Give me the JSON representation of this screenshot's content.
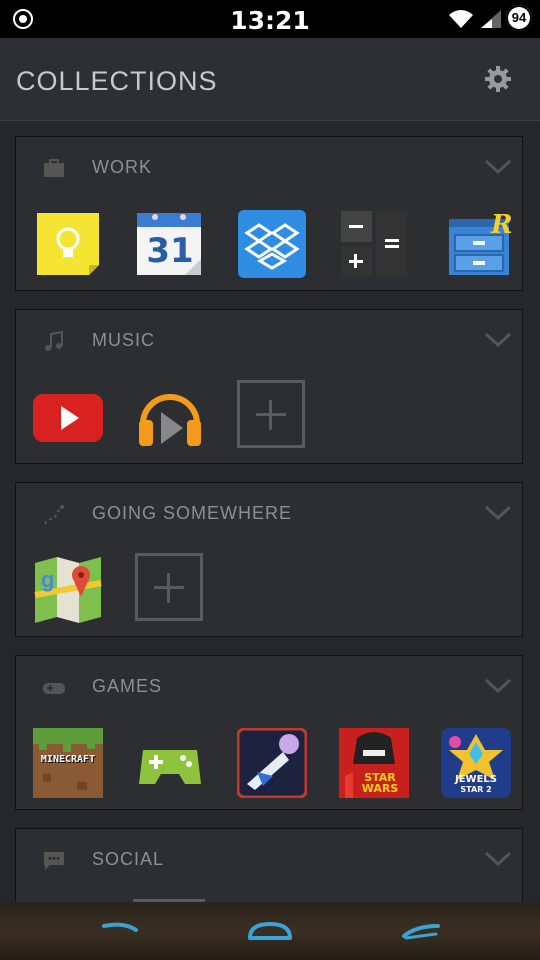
{
  "status_bar": {
    "time": "13:21",
    "battery": "94"
  },
  "header": {
    "title": "COLLECTIONS"
  },
  "collections": [
    {
      "title": "WORK",
      "icon": "briefcase-icon",
      "apps": [
        "keep-app-icon",
        "calendar-app-icon",
        "dropbox-app-icon",
        "calculator-app-icon",
        "file-explorer-app-icon"
      ],
      "calendar_day": "31"
    },
    {
      "title": "MUSIC",
      "icon": "music-note-icon",
      "apps": [
        "youtube-app-icon",
        "play-music-app-icon"
      ],
      "has_add": true
    },
    {
      "title": "GOING SOMEWHERE",
      "icon": "route-icon",
      "apps": [
        "maps-app-icon"
      ],
      "has_add": true
    },
    {
      "title": "GAMES",
      "icon": "gamepad-icon",
      "apps": [
        "minecraft-app-icon",
        "play-games-app-icon",
        "space-shooter-app-icon",
        "angry-birds-star-wars-app-icon",
        "jewels-star-2-app-icon"
      ],
      "minecraft_label": "MINECRAFT",
      "star_wars_label": "STAR WARS",
      "jewels_label": "JEWELS",
      "jewels_sub": "STAR 2"
    },
    {
      "title": "SOCIAL",
      "icon": "chat-icon",
      "apps": []
    }
  ],
  "colors": {
    "background": "#26272a",
    "card": "#2d2e32",
    "header_text": "#c9c9cb",
    "card_text": "#8e8e93",
    "nav_accent": "#3aa3d6"
  }
}
